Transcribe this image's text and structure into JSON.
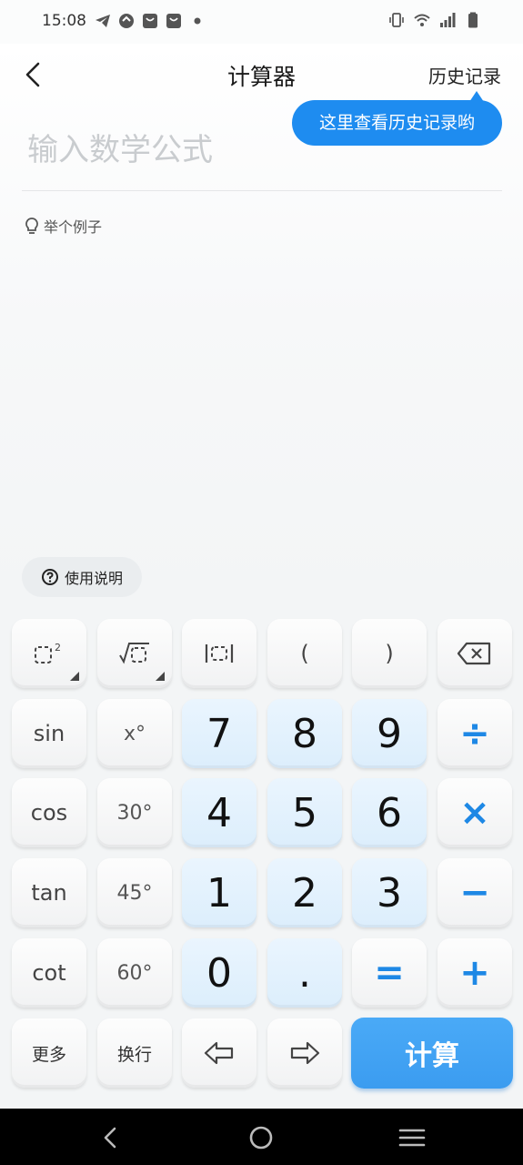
{
  "status_bar": {
    "time": "15:08",
    "left_icons": [
      "telegram-icon",
      "app-icon",
      "bag-icon",
      "bag-icon",
      "dot-icon"
    ],
    "right_icons": [
      "vibrate-icon",
      "wifi-icon",
      "signal-icon",
      "battery-icon"
    ]
  },
  "header": {
    "title": "计算器",
    "history_label": "历史记录",
    "back_icon": "chevron-left-icon"
  },
  "tooltip": {
    "text": "这里查看历史记录哟"
  },
  "input": {
    "placeholder": "输入数学公式",
    "value": ""
  },
  "example": {
    "label": "举个例子",
    "icon": "lightbulb-icon"
  },
  "manual": {
    "label": "使用说明",
    "icon": "help-circle-icon"
  },
  "keypad": {
    "row1": [
      "□²",
      "√□",
      "|□|",
      "(",
      ")",
      "⌫"
    ],
    "functions": [
      "sin",
      "cos",
      "tan",
      "cot",
      "更多"
    ],
    "degree_keys": [
      "x°",
      "30°",
      "45°",
      "60°",
      "换行"
    ],
    "digits": [
      "7",
      "8",
      "9",
      "4",
      "5",
      "6",
      "1",
      "2",
      "3",
      "0",
      "."
    ],
    "operators": [
      "÷",
      "×",
      "−",
      "=",
      "+"
    ],
    "cursor_left_icon": "arrow-left-icon",
    "cursor_right_icon": "arrow-right-icon",
    "calculate_label": "计算"
  },
  "colors": {
    "accent": "#1e8cf0",
    "operator": "#1e88e5",
    "digit_key_bg": "#e3f1fd"
  },
  "nav": {
    "icons": [
      "back-icon",
      "home-icon",
      "menu-icon"
    ]
  }
}
